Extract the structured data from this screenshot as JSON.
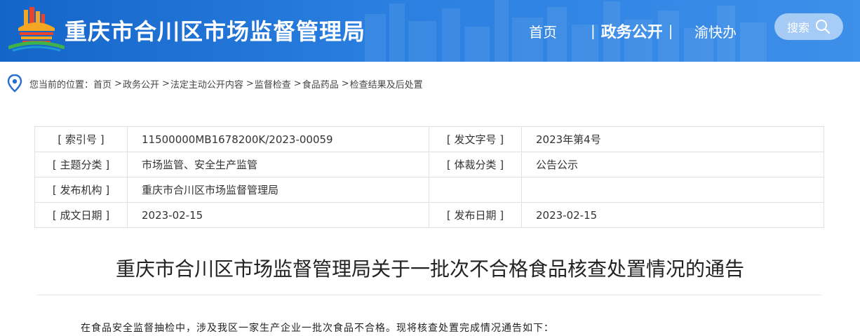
{
  "header": {
    "site_title": "重庆市合川区市场监督管理局",
    "nav": {
      "home": "首页",
      "gov_affairs": "政务公开",
      "yukuaiban": "渝快办",
      "separator": "|"
    },
    "search_label": "搜索"
  },
  "breadcrumb": {
    "prefix": "您当前的位置：",
    "items": [
      "首页",
      "政务公开",
      "法定主动公开内容",
      "监督检查",
      "食品药品",
      "检查结果及后处置"
    ],
    "sep": ">"
  },
  "meta_table": {
    "rows": [
      {
        "label1": "[ 索引号 ]",
        "value1": "11500000MB1678200K/2023-00059",
        "label2": "[ 发文字号 ]",
        "value2": "2023年第4号"
      },
      {
        "label1": "[ 主题分类 ]",
        "value1": "市场监管、安全生产监管",
        "label2": "[ 体裁分类 ]",
        "value2": "公告公示"
      },
      {
        "label1": "[ 发布机构 ]",
        "value1": "重庆市合川区市场监督管理局",
        "label2": "",
        "value2": ""
      },
      {
        "label1": "[ 成文日期 ]",
        "value1": "2023-02-15",
        "label2": "[ 发布日期 ]",
        "value2": "2023-02-15"
      }
    ]
  },
  "article": {
    "title": "重庆市合川区市场监督管理局关于一批次不合格食品核查处置情况的通告",
    "first_paragraph": "在食品安全监督抽检中，涉及我区一家生产企业一批次食品不合格。现将核查处置完成情况通告如下："
  },
  "colors": {
    "header_bg": "#1e6fd0",
    "search_bg": "#a7c6ef"
  },
  "icons": {
    "logo": "building-logo-icon",
    "search": "search-icon",
    "location": "location-pin-icon"
  }
}
